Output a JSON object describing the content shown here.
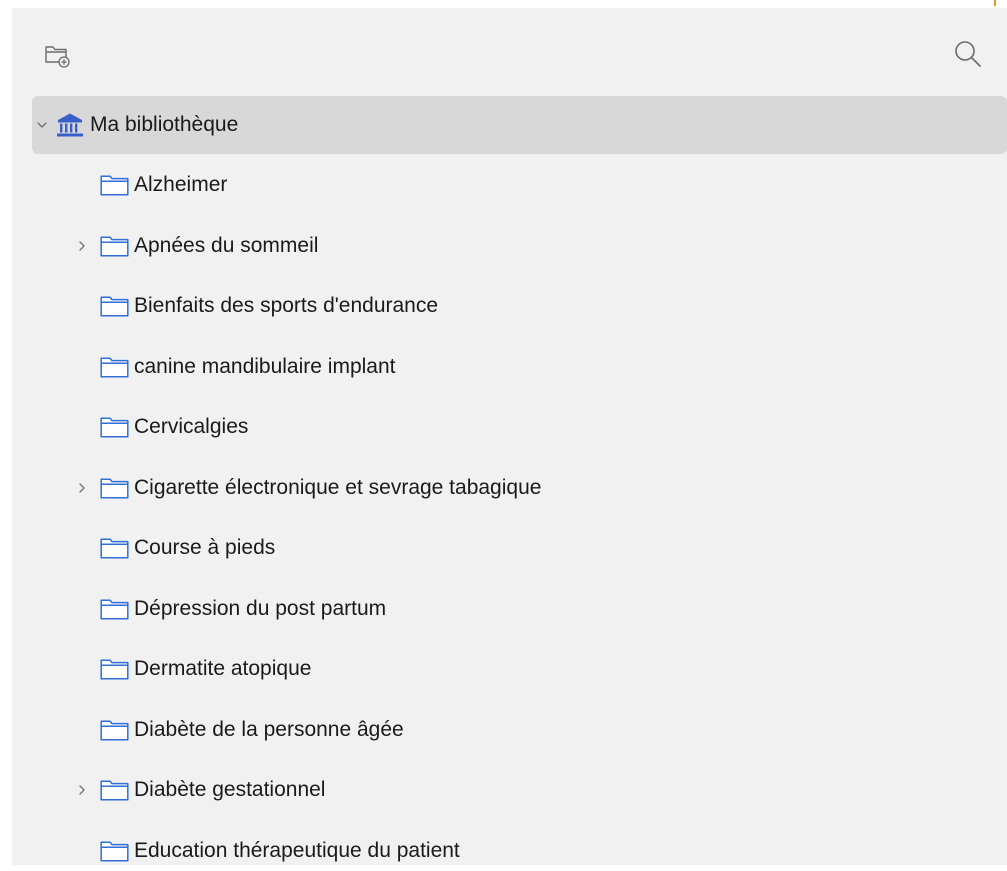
{
  "toolbar": {
    "new_collection_icon": "folder-plus-icon",
    "search_icon": "search-icon"
  },
  "colors": {
    "panel_bg": "#f1f1f1",
    "selected_row_bg": "#d8d8d8",
    "folder_stroke": "#2f6fd6",
    "library_icon": "#3a5fc9",
    "accent": "#e8912e"
  },
  "library": {
    "label": "Ma bibliothèque",
    "icon": "library-icon",
    "expanded": true,
    "collections": [
      {
        "label": "Alzheimer",
        "has_children": false
      },
      {
        "label": "Apnées du sommeil",
        "has_children": true
      },
      {
        "label": "Bienfaits des sports d'endurance",
        "has_children": false
      },
      {
        "label": "canine mandibulaire implant",
        "has_children": false
      },
      {
        "label": "Cervicalgies",
        "has_children": false
      },
      {
        "label": "Cigarette électronique et sevrage tabagique",
        "has_children": true
      },
      {
        "label": "Course à pieds",
        "has_children": false
      },
      {
        "label": "Dépression du post partum",
        "has_children": false
      },
      {
        "label": "Dermatite atopique",
        "has_children": false
      },
      {
        "label": "Diabète de la personne âgée",
        "has_children": false
      },
      {
        "label": "Diabète gestationnel",
        "has_children": true
      },
      {
        "label": "Education thérapeutique du patient",
        "has_children": false
      }
    ]
  }
}
